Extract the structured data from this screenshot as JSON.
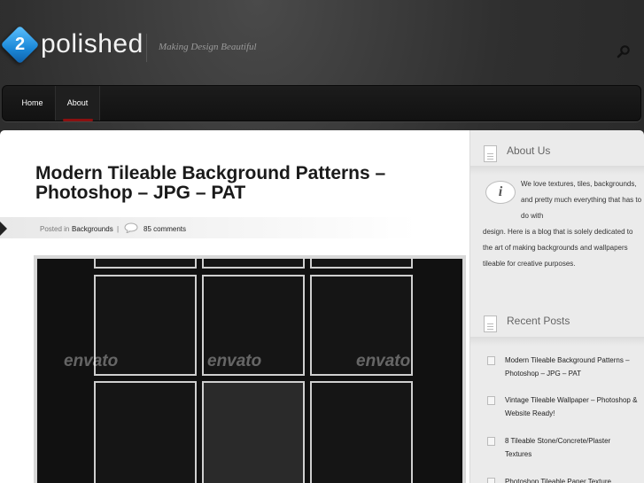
{
  "header": {
    "logo_number": "2",
    "logo_text": "polished",
    "tagline": "Making Design Beautiful"
  },
  "nav": {
    "items": [
      {
        "label": "Home"
      },
      {
        "label": "About"
      }
    ]
  },
  "post": {
    "title": "Modern Tileable Background Patterns – Photoshop – JPG – PAT",
    "posted_in_label": "Posted in",
    "category": "Backgrounds",
    "separator": "|",
    "comments": "85 comments",
    "image_watermark": "envato"
  },
  "sidebar": {
    "about": {
      "title": "About Us",
      "icon_letter": "i",
      "text_line_1": "We love textures, tiles, backgrounds, and pretty much everything that has to do with",
      "text_line_2": "design. Here is a blog that is solely dedicated to the art of making backgrounds and wallpapers tileable for creative purposes."
    },
    "recent": {
      "title": "Recent Posts",
      "items": [
        "Modern Tileable Background Patterns – Photoshop – JPG – PAT",
        "Vintage Tileable Wallpaper – Photoshop & Website Ready!",
        "8 Tileable Stone/Concrete/Plaster Textures",
        "Photoshop Tileable Paper Texture"
      ]
    }
  },
  "colors": {
    "logo_blue": "#1b88d8",
    "nav_accent": "#8b1010",
    "background": "#2b2b2b"
  }
}
